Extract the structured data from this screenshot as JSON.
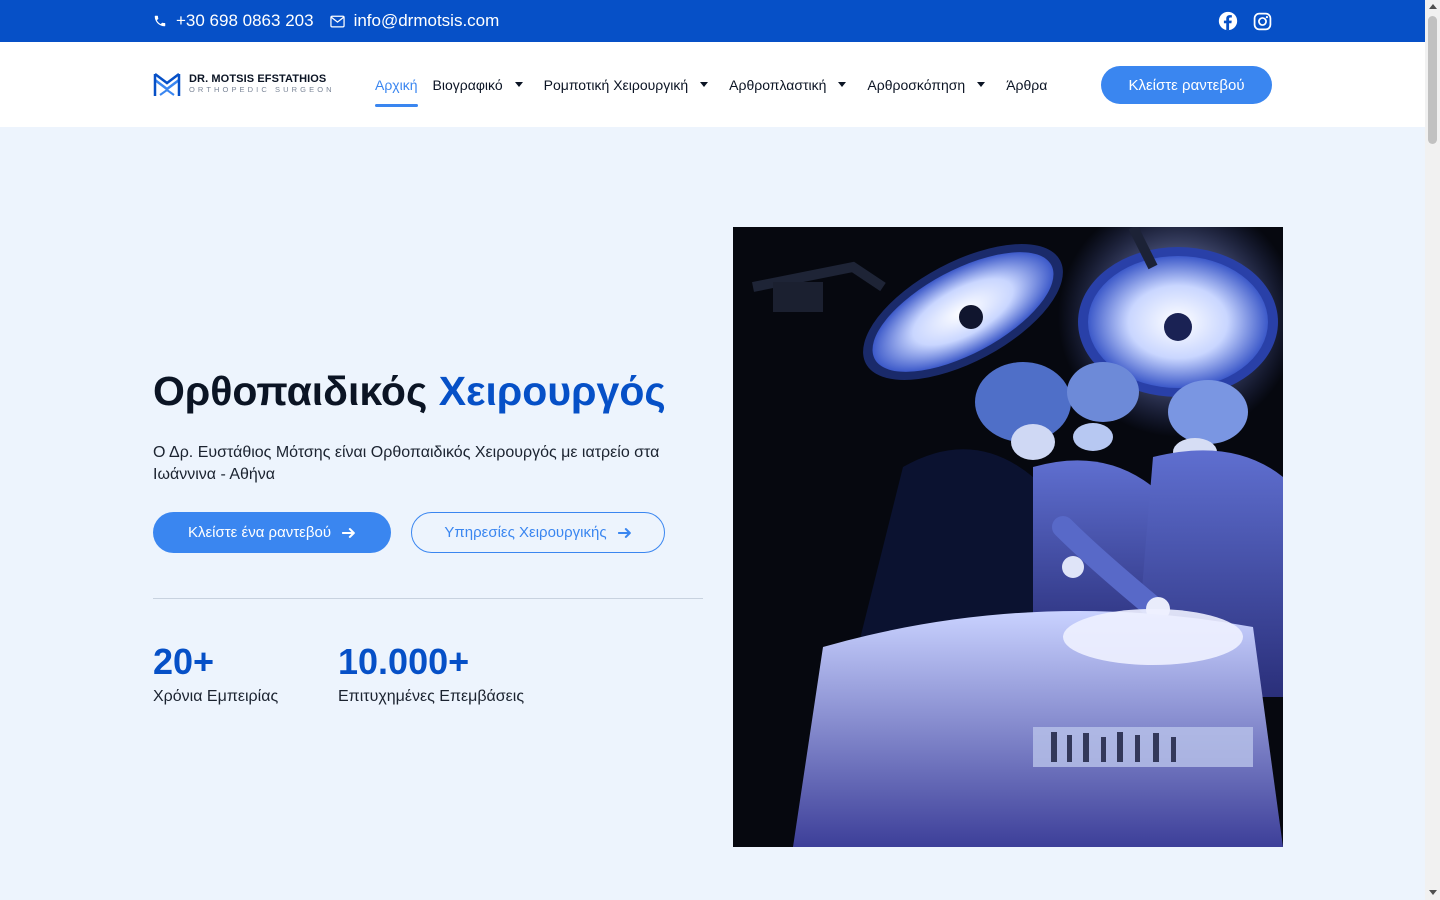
{
  "topbar": {
    "phone": "+30 698 0863 203",
    "email": "info@drmotsis.com",
    "social_icons": [
      "facebook-icon",
      "instagram-icon"
    ]
  },
  "header": {
    "logo_name": "DR. MOTSIS EFSTATHIOS",
    "logo_sub": "ORTHOPEDIC SURGEON",
    "nav": [
      {
        "label": "Αρχική",
        "active": true,
        "dropdown": false
      },
      {
        "label": "Βιογραφικό",
        "active": false,
        "dropdown": true
      },
      {
        "label": "Ρομποτική Χειρουργική",
        "active": false,
        "dropdown": true
      },
      {
        "label": "Αρθροπλαστική",
        "active": false,
        "dropdown": true
      },
      {
        "label": "Αρθροσκόπηση",
        "active": false,
        "dropdown": true
      },
      {
        "label": "Άρθρα",
        "active": false,
        "dropdown": false
      }
    ],
    "cta": "Κλείστε ραντεβού"
  },
  "hero": {
    "title_main": "Ορθοπαιδικός",
    "title_accent": "Χειρουργός",
    "description": "Ο Δρ. Ευστάθιος Μότσης είναι Ορθοπαιδικός Χειρουργός με ιατρείο στα Ιωάννινα - Αθήνα",
    "btn_primary": "Κλείστε ένα ραντεβού",
    "btn_secondary": "Υπηρεσίες Χειρουργικής",
    "stats": [
      {
        "number": "20+",
        "label": "Χρόνια Εμπειρίας"
      },
      {
        "number": "10.000+",
        "label": "Επιτυχημένες Επεμβάσεις"
      }
    ]
  },
  "colors": {
    "primary": "#0650c7",
    "accent": "#3a86f0",
    "background": "#edf4fd"
  }
}
